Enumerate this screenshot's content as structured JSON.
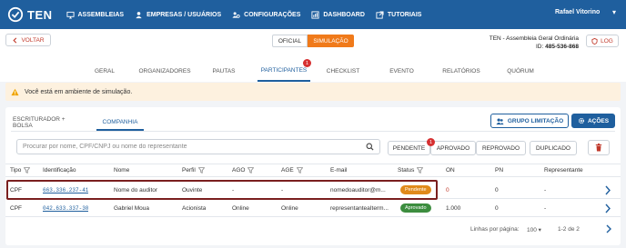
{
  "app": {
    "logo_text": "TEN"
  },
  "nav": [
    {
      "label": "ASSEMBLEIAS",
      "icon": "monitor-icon"
    },
    {
      "label": "EMPRESAS / USUÁRIOS",
      "icon": "users-icon"
    },
    {
      "label": "CONFIGURAÇÕES",
      "icon": "users-gear-icon"
    },
    {
      "label": "DASHBOARD",
      "icon": "dashboard-icon"
    },
    {
      "label": "TUTORIAIS",
      "icon": "external-link-icon"
    }
  ],
  "user": {
    "name": "Rafael Vitorino"
  },
  "subbar": {
    "back_label": "VOLTAR",
    "mode_official": "OFICIAL",
    "mode_simulation": "SIMULAÇÃO",
    "event_title": "TEN - Assembleia Geral Ordinária",
    "event_id_label": "ID:",
    "event_id": "485-536-868",
    "log_label": "LOG"
  },
  "tabs": [
    {
      "label": "GERAL"
    },
    {
      "label": "ORGANIZADORES"
    },
    {
      "label": "PAUTAS"
    },
    {
      "label": "PARTICIPANTES",
      "badge": "1",
      "active": true
    },
    {
      "label": "CHECKLIST"
    },
    {
      "label": "EVENTO"
    },
    {
      "label": "RELATÓRIOS"
    },
    {
      "label": "QUÓRUM"
    }
  ],
  "alert": {
    "text": "Você está em ambiente de simulação.",
    "color": "#fdf1df"
  },
  "panel": {
    "subtabs": [
      "ESCRITURADOR + BOLSA",
      "COMPANHIA"
    ],
    "group_limit_label": "GRUPO LIMITAÇÃO",
    "actions_label": "AÇÕES",
    "search_placeholder": "Procurar por nome, CPF/CNPJ ou nome do representante",
    "filters": [
      {
        "label": "PENDENTE"
      },
      {
        "label": "APROVADO",
        "badge": "1"
      },
      {
        "label": "REPROVADO"
      },
      {
        "label": "DUPLICADO"
      }
    ]
  },
  "table": {
    "headers": [
      "Tipo",
      "Identificação",
      "Nome",
      "Perfil",
      "AGO",
      "AGE",
      "E-mail",
      "Status",
      "ON",
      "PN",
      "Representante"
    ],
    "rows": [
      {
        "tipo": "CPF",
        "id": "663.336.237-41",
        "nome": "Nome do auditor",
        "perfil": "Ouvinte",
        "ago": "-",
        "age": "-",
        "email": "nomedoauditor@m...",
        "status": "Pendente",
        "on": "0",
        "pn": "0",
        "rep": "-"
      },
      {
        "tipo": "CPF",
        "id": "042.633.337-30",
        "nome": "Gabriel Moua",
        "perfil": "Acionista",
        "ago": "Online",
        "age": "Online",
        "email": "representanteaIterm...",
        "status": "Aprovado",
        "on": "1.000",
        "pn": "0",
        "rep": "-"
      }
    ]
  },
  "pager": {
    "rows_label": "Linhas por página:",
    "rows_value": "100",
    "range": "1-2 de 2"
  },
  "colors": {
    "brand": "#1f5f9e",
    "accent": "#f07a1a",
    "pending": "#e08a1b",
    "approved": "#3c8d3f",
    "danger": "#c0392b"
  }
}
